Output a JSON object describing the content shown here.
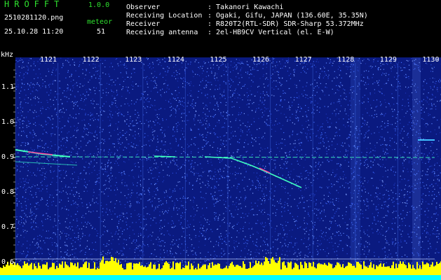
{
  "header": {
    "brand": "HROFFT",
    "version": "1.0.0",
    "filename": "2510281120.png",
    "datetime": "25.10.28 11:20",
    "count_label": "meteor",
    "count_value": "51",
    "info": [
      {
        "key": "Observer",
        "value": ": Takanori Kawachi"
      },
      {
        "key": "Receiving Location",
        "value": ": Ogaki, Gifu, JAPAN (136.60E, 35.35N)"
      },
      {
        "key": "Receiver",
        "value": ": R820T2(RTL-SDR) SDR-Sharp 53.372MHz"
      },
      {
        "key": "Receiving antenna",
        "value": ": 2el-HB9CV Vertical (el. E-W)"
      }
    ]
  },
  "axis": {
    "unit": "kHz",
    "x_ticks": [
      "1121",
      "1122",
      "1123",
      "1124",
      "1125",
      "1126",
      "1127",
      "1128",
      "1129",
      "1130"
    ],
    "y_ticks": [
      "1.1",
      "1.0",
      "0.9",
      "0.8",
      "0.7",
      "0.6"
    ]
  },
  "colors": {
    "background": "#0a1a80",
    "noise": "#3f6cff",
    "trace": "#40ffc0",
    "meteor_hit": "#ff40a0",
    "histogram": "#ffff00",
    "floor": "#00ffff"
  }
}
